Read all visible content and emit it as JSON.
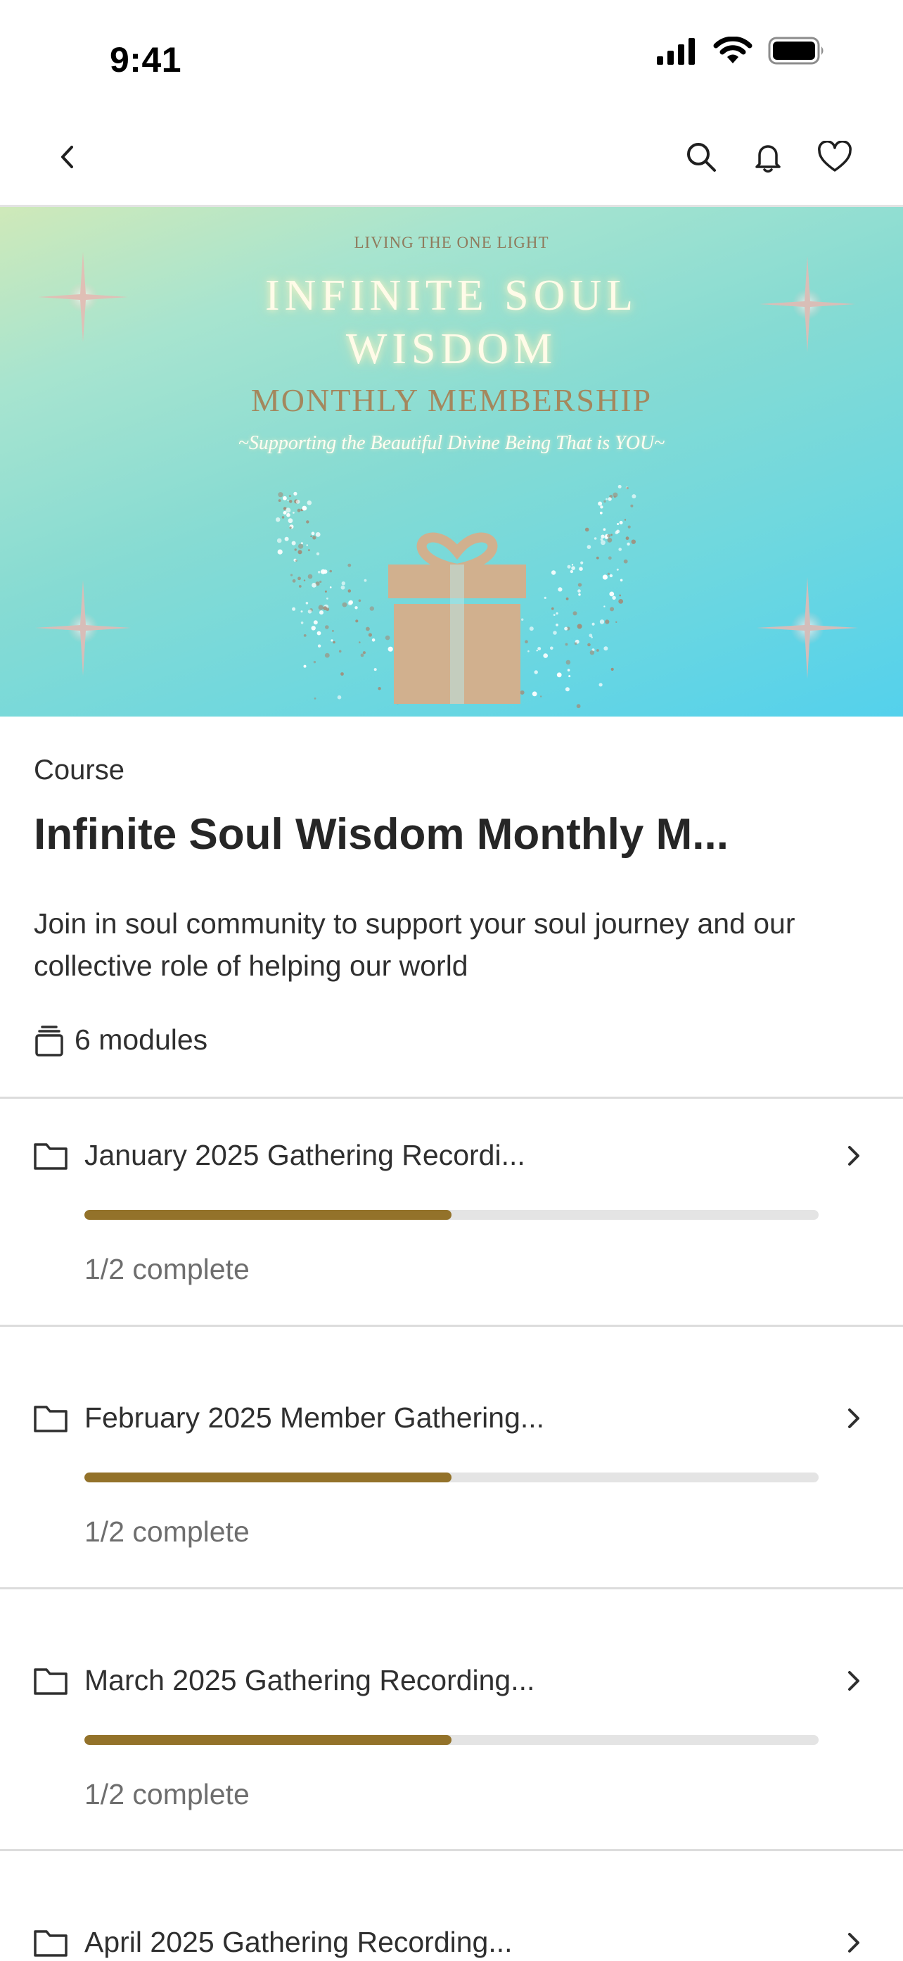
{
  "status_bar": {
    "time": "9:41"
  },
  "hero": {
    "tag": "LIVING THE ONE  LIGHT",
    "title_line1": "INFINITE SOUL",
    "title_line2": "WISDOM",
    "subtitle": "MONTHLY MEMBERSHIP",
    "tagline": "~Supporting the Beautiful Divine Being That is YOU~",
    "colors": {
      "gift": "#d1b08e",
      "sparkle": "#e8b9b3"
    }
  },
  "course": {
    "eyebrow": "Course",
    "title": "Infinite Soul Wisdom Monthly M...",
    "description": "Join in soul community to support your soul journey and our collective role of helping our world",
    "modules_count": "6 modules"
  },
  "modules": [
    {
      "title": "January 2025 Gathering Recordi...",
      "status": "1/2 complete",
      "progress": 0.5
    },
    {
      "title": "February 2025 Member Gathering...",
      "status": "1/2 complete",
      "progress": 0.5
    },
    {
      "title": "March 2025 Gathering Recording...",
      "status": "1/2 complete",
      "progress": 0.5
    },
    {
      "title": "April 2025 Gathering Recording...",
      "status": "",
      "progress": 0
    }
  ],
  "colors": {
    "progress_fill": "#93722a",
    "progress_track": "#e4e4e4",
    "divider": "#dcdcdc"
  },
  "icons": [
    "back-icon",
    "search-icon",
    "bell-icon",
    "heart-icon",
    "modules-stack-icon",
    "folder-icon",
    "chevron-right-icon"
  ]
}
